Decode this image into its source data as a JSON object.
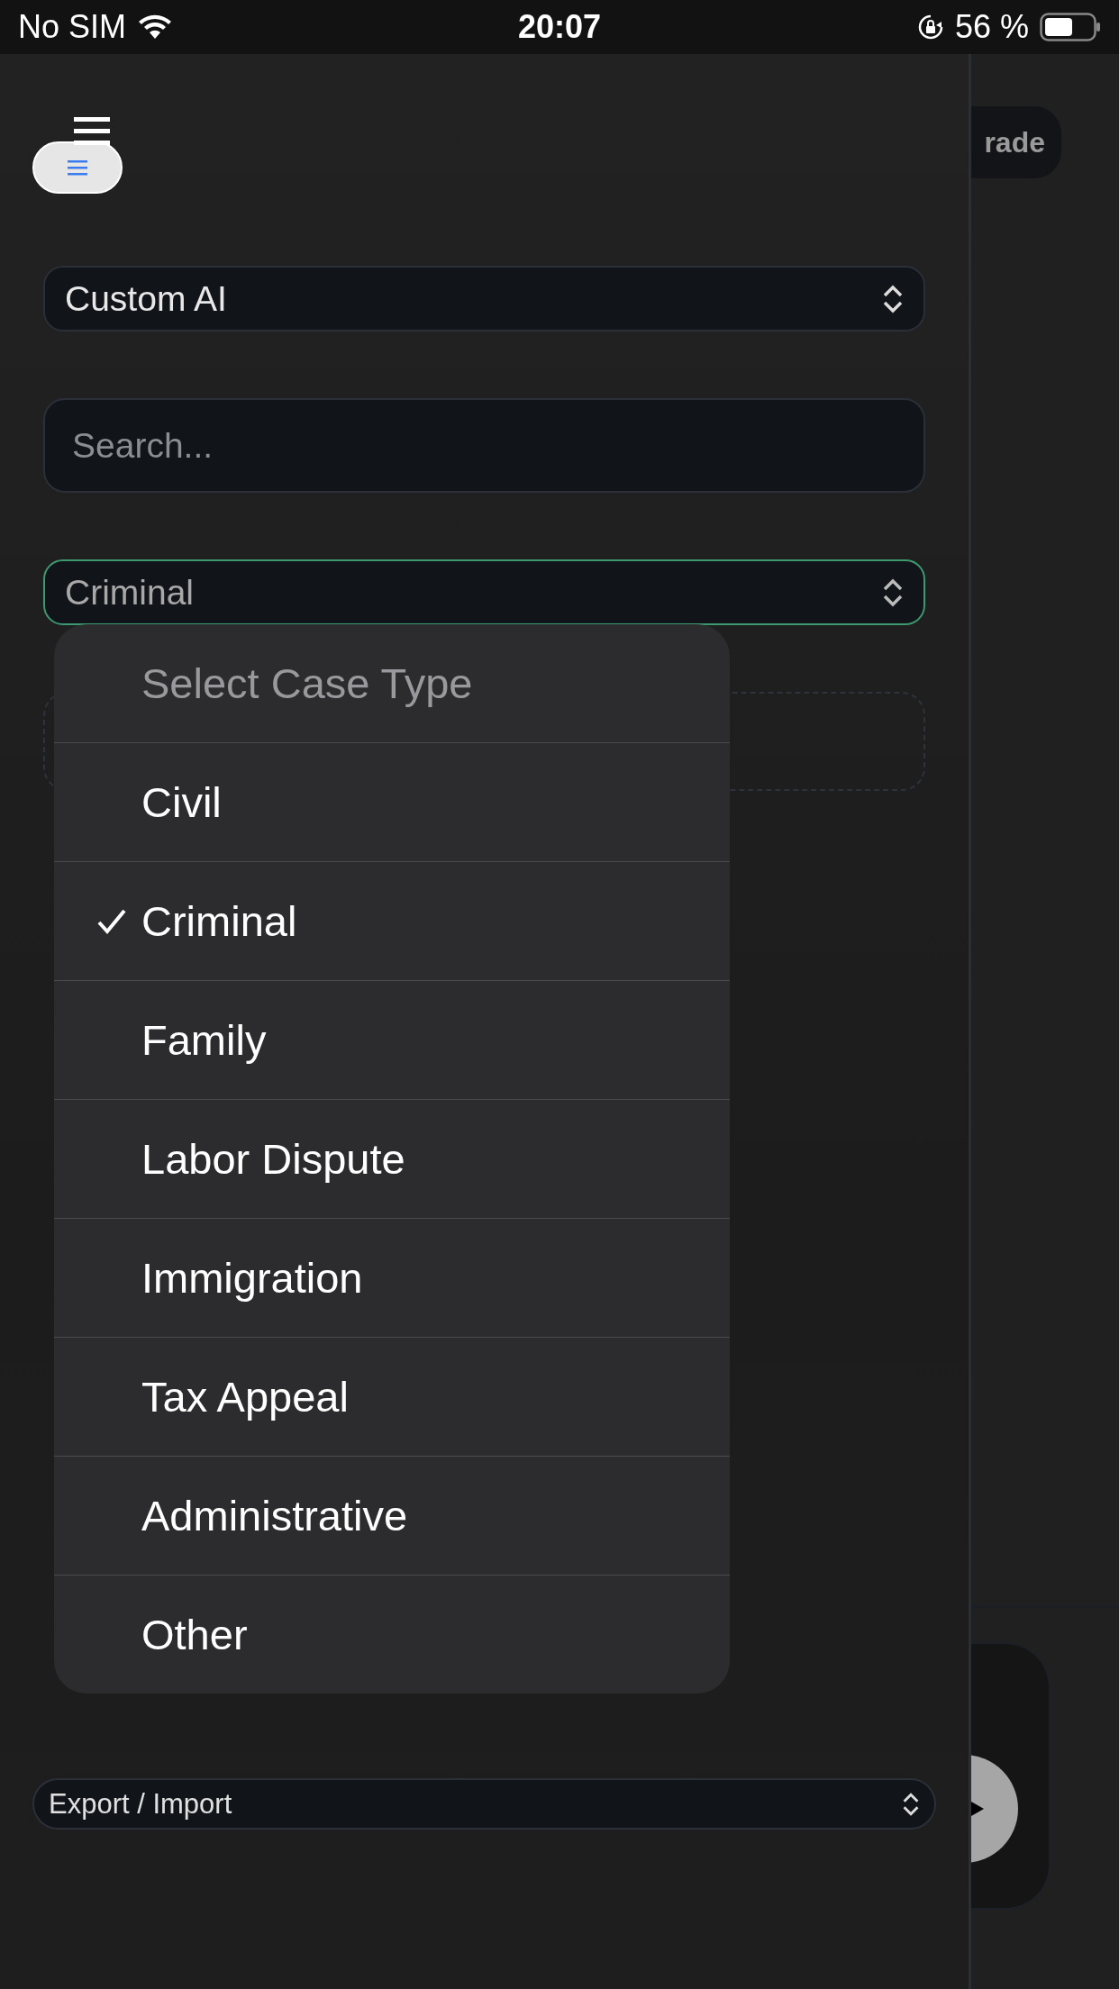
{
  "status_bar": {
    "carrier": "No SIM",
    "time": "20:07",
    "battery": "56 %"
  },
  "header": {
    "upgrade_label": "rade"
  },
  "sidebar": {
    "model_select": {
      "value": "Custom AI"
    },
    "search": {
      "placeholder": "Search..."
    },
    "case_type_select": {
      "value": "Criminal",
      "open": true
    },
    "export_select": {
      "value": "Export / Import"
    }
  },
  "dropdown": {
    "items": [
      {
        "label": "Select Case Type",
        "kind": "placeholder",
        "selected": false
      },
      {
        "label": "Civil",
        "kind": "option",
        "selected": false
      },
      {
        "label": "Criminal",
        "kind": "option",
        "selected": true
      },
      {
        "label": "Family",
        "kind": "option",
        "selected": false
      },
      {
        "label": "Labor Dispute",
        "kind": "option",
        "selected": false
      },
      {
        "label": "Immigration",
        "kind": "option",
        "selected": false
      },
      {
        "label": "Tax Appeal",
        "kind": "option",
        "selected": false
      },
      {
        "label": "Administrative",
        "kind": "option",
        "selected": false
      },
      {
        "label": "Other",
        "kind": "option",
        "selected": false
      }
    ]
  }
}
